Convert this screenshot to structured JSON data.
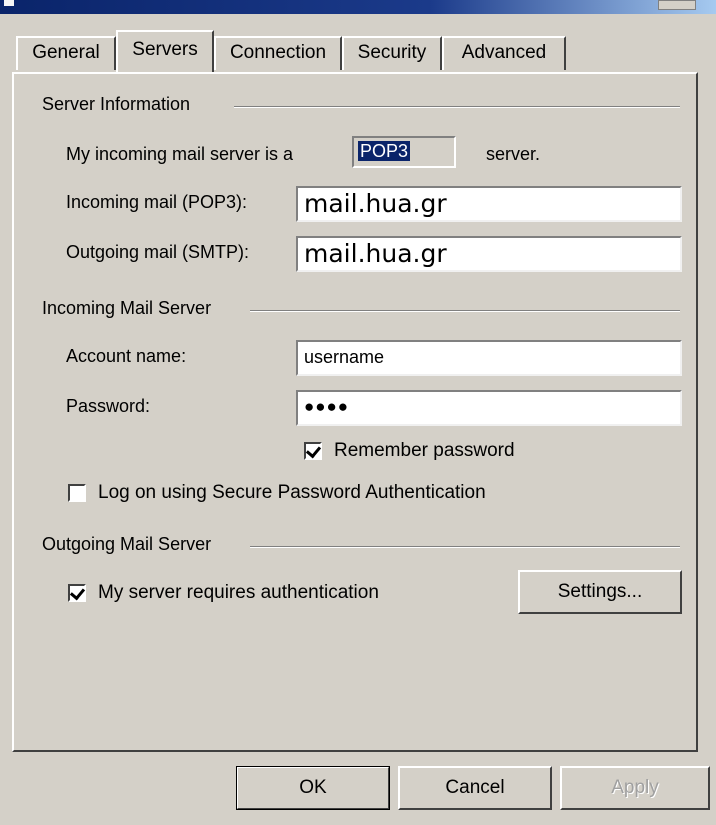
{
  "tabs": [
    {
      "label": "General"
    },
    {
      "label": "Servers"
    },
    {
      "label": "Connection"
    },
    {
      "label": "Security"
    },
    {
      "label": "Advanced"
    }
  ],
  "server_info": {
    "title": "Server Information",
    "incoming_type_prefix": "My incoming mail server is a",
    "incoming_type_value": "POP3",
    "incoming_type_suffix": "server.",
    "incoming_label": "Incoming mail (POP3):",
    "incoming_value": "mail.hua.gr",
    "outgoing_label": "Outgoing mail (SMTP):",
    "outgoing_value": "mail.hua.gr"
  },
  "incoming_server": {
    "title": "Incoming Mail Server",
    "account_label": "Account name:",
    "account_value": "username",
    "password_label": "Password:",
    "password_value": "●●●●",
    "remember_label": "Remember password",
    "remember_checked": true,
    "spa_label": "Log on using Secure Password Authentication",
    "spa_checked": false
  },
  "outgoing_server": {
    "title": "Outgoing Mail Server",
    "auth_label": "My server requires authentication",
    "auth_checked": true,
    "settings_label": "Settings..."
  },
  "buttons": {
    "ok": "OK",
    "cancel": "Cancel",
    "apply": "Apply"
  }
}
